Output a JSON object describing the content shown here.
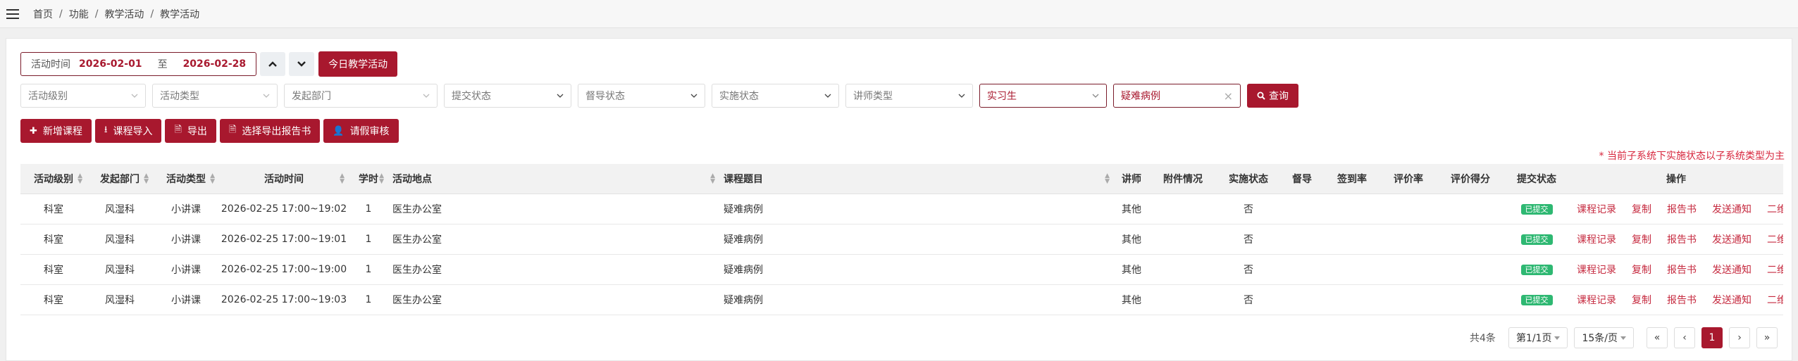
{
  "breadcrumb": [
    "首页",
    "功能",
    "教学活动",
    "教学活动"
  ],
  "date_filter": {
    "label": "活动时间",
    "start": "2026-02-01",
    "sep": "至",
    "end": "2026-02-28"
  },
  "today_label": "今日教学活动",
  "filters": [
    {
      "label": "活动级别",
      "value": ""
    },
    {
      "label": "活动类型",
      "value": ""
    },
    {
      "label": "发起部门",
      "value": ""
    },
    {
      "label": "提交状态",
      "value": ""
    },
    {
      "label": "督导状态",
      "value": ""
    },
    {
      "label": "实施状态",
      "value": ""
    },
    {
      "label": "讲师类型",
      "value": ""
    },
    {
      "label": "实习生",
      "value": "实习生"
    }
  ],
  "search": {
    "value": "疑难病例"
  },
  "query_label": "查询",
  "actions": [
    "新增课程",
    "课程导入",
    "导出",
    "选择导出报告书",
    "请假审核"
  ],
  "note": "* 当前子系统下实施状态以子系统类型为主",
  "columns": [
    "活动级别",
    "发起部门",
    "活动类型",
    "活动时间",
    "学时",
    "活动地点",
    "课程题目",
    "讲师",
    "附件情况",
    "实施状态",
    "督导",
    "签到率",
    "评价率",
    "评价得分",
    "提交状态",
    "操作"
  ],
  "rows": [
    {
      "level": "科室",
      "dept": "风湿科",
      "type": "小讲课",
      "time": "2026-02-25  17:00~19:02",
      "hours": "1",
      "place": "医生办公室",
      "topic": "疑难病例",
      "lecturer": "其他",
      "attach": "",
      "impl": "否",
      "supervise": "",
      "sign": "",
      "eval": "",
      "score": "",
      "submit": "已提交"
    },
    {
      "level": "科室",
      "dept": "风湿科",
      "type": "小讲课",
      "time": "2026-02-25  17:00~19:01",
      "hours": "1",
      "place": "医生办公室",
      "topic": "疑难病例",
      "lecturer": "其他",
      "attach": "",
      "impl": "否",
      "supervise": "",
      "sign": "",
      "eval": "",
      "score": "",
      "submit": "已提交"
    },
    {
      "level": "科室",
      "dept": "风湿科",
      "type": "小讲课",
      "time": "2026-02-25  17:00~19:00",
      "hours": "1",
      "place": "医生办公室",
      "topic": "疑难病例",
      "lecturer": "其他",
      "attach": "",
      "impl": "否",
      "supervise": "",
      "sign": "",
      "eval": "",
      "score": "",
      "submit": "已提交"
    },
    {
      "level": "科室",
      "dept": "风湿科",
      "type": "小讲课",
      "time": "2026-02-25  17:00~19:03",
      "hours": "1",
      "place": "医生办公室",
      "topic": "疑难病例",
      "lecturer": "其他",
      "attach": "",
      "impl": "否",
      "supervise": "",
      "sign": "",
      "eval": "",
      "score": "",
      "submit": "已提交"
    }
  ],
  "row_ops": [
    "课程记录",
    "复制",
    "报告书",
    "发送通知",
    "二维码"
  ],
  "pagination": {
    "total": "共4条",
    "page": "第1/1页",
    "size": "15条/页",
    "current": "1",
    "first": "«",
    "prev": "‹",
    "next": "›",
    "last": "»"
  },
  "colors": {
    "brand": "#a8182e",
    "badge": "#2eb872",
    "note": "#d7263d"
  }
}
